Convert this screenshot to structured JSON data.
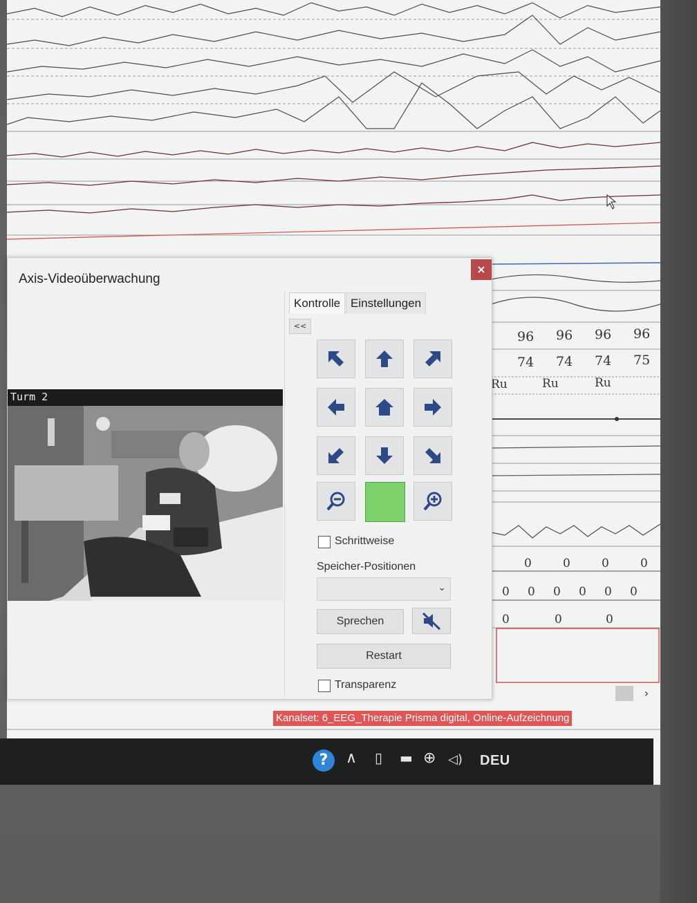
{
  "window": {
    "title": "Axis-Videoüberwachung",
    "close_label": "×"
  },
  "video": {
    "camera_label": "Turm 2"
  },
  "control": {
    "tabs": [
      "Kontrolle",
      "Einstellungen"
    ],
    "collapse_label": "<<",
    "stepwise_label": "Schrittweise",
    "presets_label": "Speicher-Positionen",
    "presets_selected": "",
    "speak_label": "Sprechen",
    "restart_label": "Restart",
    "transparency_label": "Transparenz",
    "ptz_buttons": [
      "arrow-up-left-icon",
      "arrow-up-icon",
      "arrow-up-right-icon",
      "arrow-left-icon",
      "home-icon",
      "arrow-right-icon",
      "arrow-down-left-icon",
      "arrow-down-icon",
      "arrow-down-right-icon",
      "zoom-out-icon",
      "zoom-in-icon"
    ],
    "preview_color": "#7cd16a",
    "stepwise_checked": false,
    "transparency_checked": false
  },
  "readouts": {
    "row1": [
      "96",
      "96",
      "96",
      "96"
    ],
    "row2": [
      "74",
      "74",
      "74",
      "75"
    ],
    "row3": [
      "Ru",
      "Ru",
      "Ru"
    ],
    "row4": [
      "0",
      "0",
      "0",
      "0"
    ],
    "row5": [
      "0",
      "0",
      "0",
      "0",
      "0",
      "0"
    ],
    "row6": [
      "0",
      "0",
      "0"
    ]
  },
  "status": {
    "channel_set": "Kanalset: 6_EEG_Therapie Prisma digital,  Online-Aufzeichnung",
    "color": "#e05657"
  },
  "taskbar": {
    "language": "DEU",
    "tray_icons": [
      "help-icon",
      "chevron-up-icon",
      "device-icon",
      "battery-icon",
      "globe-icon",
      "speaker-icon"
    ]
  }
}
